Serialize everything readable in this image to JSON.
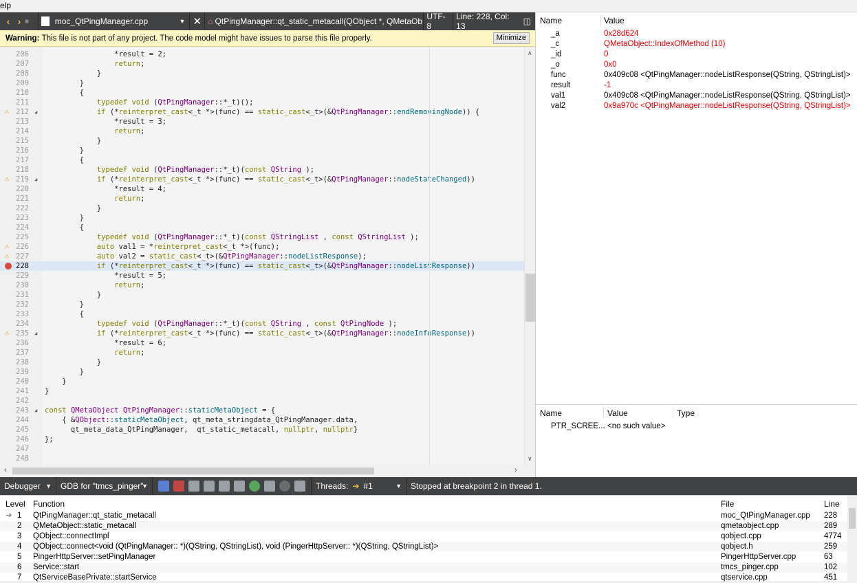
{
  "menubar": {
    "help": "elp"
  },
  "editor_toolbar": {
    "filename": "moc_QtPingManager.cpp",
    "symbol": "QtPingManager::qt_static_metacall(QObject *, QMetaOb…",
    "encoding": "UTF-8",
    "position": "Line: 228, Col: 13"
  },
  "warning": {
    "prefix": "Warning:",
    "text": "This file is not part of any project. The code model might have issues to parse this file properly.",
    "minimize_label": "Minimize"
  },
  "code_lines": [
    {
      "n": "206",
      "t": "                *result = 2;"
    },
    {
      "n": "207",
      "t": "                return;"
    },
    {
      "n": "208",
      "t": "            }"
    },
    {
      "n": "209",
      "t": "        }"
    },
    {
      "n": "210",
      "t": "        {"
    },
    {
      "n": "211",
      "t": "            typedef void (QtPingManager::*_t)();"
    },
    {
      "n": "212",
      "t": "            if (*reinterpret_cast<_t *>(func) == static_cast<_t>(&QtPingManager::endRemovingNode)) {",
      "warn": true,
      "fold": true
    },
    {
      "n": "213",
      "t": "                *result = 3;"
    },
    {
      "n": "214",
      "t": "                return;"
    },
    {
      "n": "215",
      "t": "            }"
    },
    {
      "n": "216",
      "t": "        }"
    },
    {
      "n": "217",
      "t": "        {"
    },
    {
      "n": "218",
      "t": "            typedef void (QtPingManager::*_t)(const QString );"
    },
    {
      "n": "219",
      "t": "            if (*reinterpret_cast<_t *>(func) == static_cast<_t>(&QtPingManager::nodeStateChanged))",
      "warn": true,
      "fold": true
    },
    {
      "n": "220",
      "t": "                *result = 4;"
    },
    {
      "n": "221",
      "t": "                return;"
    },
    {
      "n": "222",
      "t": "            }"
    },
    {
      "n": "223",
      "t": "        }"
    },
    {
      "n": "224",
      "t": "        {"
    },
    {
      "n": "225",
      "t": "            typedef void (QtPingManager::*_t)(const QStringList , const QStringList );"
    },
    {
      "n": "226",
      "t": "            auto val1 = *reinterpret_cast<_t *>(func);",
      "warn": true
    },
    {
      "n": "227",
      "t": "            auto val2 = static_cast<_t>(&QtPingManager::nodeListResponse);",
      "warn": true
    },
    {
      "n": "228",
      "t": "            if (*reinterpret_cast<_t *>(func) == static_cast<_t>(&QtPingManager::nodeListResponse))",
      "bp": true,
      "current": true
    },
    {
      "n": "229",
      "t": "                *result = 5;"
    },
    {
      "n": "230",
      "t": "                return;"
    },
    {
      "n": "231",
      "t": "            }"
    },
    {
      "n": "232",
      "t": "        }"
    },
    {
      "n": "233",
      "t": "        {"
    },
    {
      "n": "234",
      "t": "            typedef void (QtPingManager::*_t)(const QString , const QtPingNode );"
    },
    {
      "n": "235",
      "t": "            if (*reinterpret_cast<_t *>(func) == static_cast<_t>(&QtPingManager::nodeInfoResponse))",
      "warn": true,
      "fold": true
    },
    {
      "n": "236",
      "t": "                *result = 6;"
    },
    {
      "n": "237",
      "t": "                return;"
    },
    {
      "n": "238",
      "t": "            }"
    },
    {
      "n": "239",
      "t": "        }"
    },
    {
      "n": "240",
      "t": "    }"
    },
    {
      "n": "241",
      "t": "}"
    },
    {
      "n": "242",
      "t": ""
    },
    {
      "n": "243",
      "t": "const QMetaObject QtPingManager::staticMetaObject = {",
      "fold": true
    },
    {
      "n": "244",
      "t": "    { &QObject::staticMetaObject, qt_meta_stringdata_QtPingManager.data,"
    },
    {
      "n": "245",
      "t": "      qt_meta_data_QtPingManager,  qt_static_metacall, nullptr, nullptr}"
    },
    {
      "n": "246",
      "t": "};"
    },
    {
      "n": "247",
      "t": ""
    },
    {
      "n": "248",
      "t": ""
    }
  ],
  "locals": {
    "headers": {
      "name": "Name",
      "value": "Value"
    },
    "rows": [
      {
        "name": "_a",
        "value": "0x28d624",
        "changed": true
      },
      {
        "name": "_c",
        "value": "QMetaObject::IndexOfMethod (10)",
        "changed": true
      },
      {
        "name": "_id",
        "value": "0",
        "changed": true
      },
      {
        "name": "_o",
        "value": "0x0",
        "changed": true
      },
      {
        "name": "func",
        "value": "0x409c08 <QtPingManager::nodeListResponse(QString, QStringList)>",
        "changed": false
      },
      {
        "name": "result",
        "value": "-1",
        "changed": true
      },
      {
        "name": "val1",
        "value": "0x409c08 <QtPingManager::nodeListResponse(QString, QStringList)>",
        "changed": false
      },
      {
        "name": "val2",
        "value": "0x9a970c <QtPingManager::nodeListResponse(QString, QStringList)>",
        "changed": true
      }
    ]
  },
  "watch": {
    "headers": {
      "name": "Name",
      "value": "Value",
      "type": "Type"
    },
    "rows": [
      {
        "name": "PTR_SCREE...",
        "value": "<no such value>",
        "type": ""
      }
    ]
  },
  "debugger_bar": {
    "mode": "Debugger",
    "engine": "GDB for \"tmcs_pinger\"",
    "threads_label": "Threads:",
    "thread_value": "#1",
    "status": "Stopped at breakpoint 2 in thread 1."
  },
  "stack": {
    "headers": {
      "level": "Level",
      "function": "Function",
      "file": "File",
      "line": "Line"
    },
    "rows": [
      {
        "level": "1",
        "function": "QtPingManager::qt_static_metacall",
        "file": "moc_QtPingManager.cpp",
        "line": "228",
        "current": true
      },
      {
        "level": "2",
        "function": "QMetaObject::static_metacall",
        "file": "qmetaobject.cpp",
        "line": "289"
      },
      {
        "level": "3",
        "function": "QObject::connectImpl",
        "file": "qobject.cpp",
        "line": "4774"
      },
      {
        "level": "4",
        "function": "QObject::connect<void (QtPingManager:: *)(QString, QStringList), void (PingerHttpServer:: *)(QString, QStringList)>",
        "file": "qobject.h",
        "line": "259"
      },
      {
        "level": "5",
        "function": "PingerHttpServer::setPingManager",
        "file": "PingerHttpServer.cpp",
        "line": "63"
      },
      {
        "level": "6",
        "function": "Service::start",
        "file": "tmcs_pinger.cpp",
        "line": "102"
      },
      {
        "level": "7",
        "function": "QtServiceBasePrivate::startService",
        "file": "qtservice.cpp",
        "line": "451"
      }
    ]
  }
}
